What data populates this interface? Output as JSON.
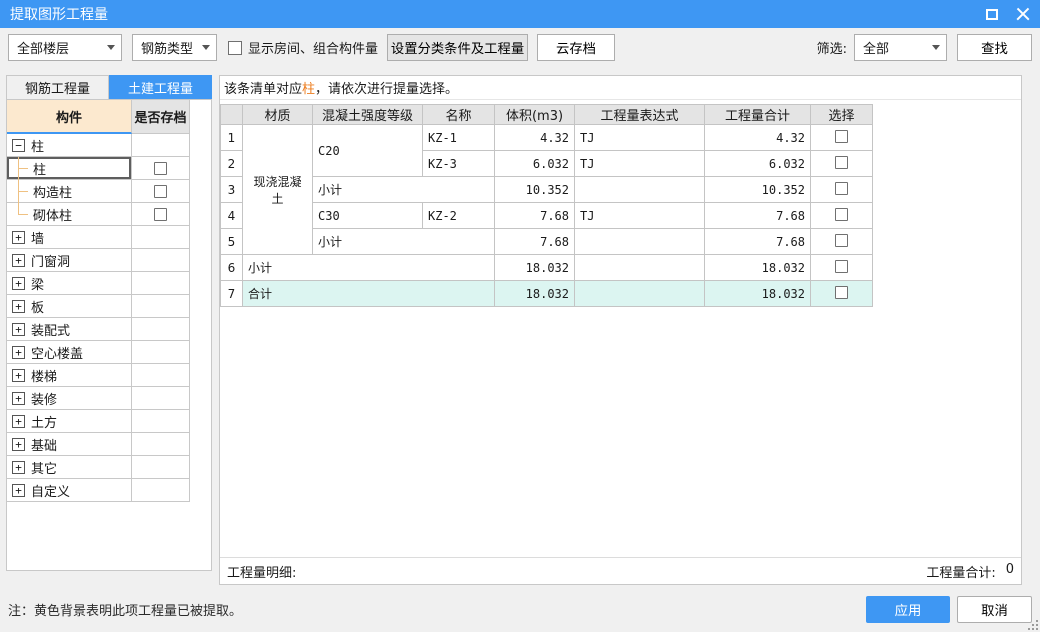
{
  "colors": {
    "accent_blue": "#3e97f3",
    "highlight_orange": "#ed7d1f",
    "tree_header_bg": "#fce9cf",
    "total_row_bg": "#dcf5f1",
    "table_header_bg": "#e4e4e4",
    "dialog_bg": "#f0f0f0"
  },
  "icons": {
    "maximize": "square-outline",
    "close": "x-cross",
    "chevron_down": "triangle-down",
    "expand_glyph": "+",
    "collapse_glyph": "−"
  },
  "window": {
    "title": "提取图形工程量"
  },
  "toolbar": {
    "floor_dropdown_value": "全部楼层",
    "rebar_type_dropdown_value": "钢筋类型",
    "show_room_checkbox_label": "显示房间、组合构件量",
    "set_conditions_button": "设置分类条件及工程量",
    "cloud_save_button": "云存档",
    "filter_label": "筛选:",
    "filter_dropdown_value": "全部",
    "find_button": "查找"
  },
  "sidebar": {
    "tabs": [
      {
        "label": "钢筋工程量",
        "active": false
      },
      {
        "label": "土建工程量",
        "active": true
      }
    ],
    "tree": {
      "headers": [
        "构件",
        "是否存档"
      ],
      "items": [
        {
          "label": "柱",
          "level": 0,
          "expander": "collapse",
          "checkbox": false,
          "selected": false
        },
        {
          "label": "柱",
          "level": 1,
          "expander": "leaf",
          "checkbox": true,
          "selected": true,
          "last": false
        },
        {
          "label": "构造柱",
          "level": 1,
          "expander": "leaf",
          "checkbox": true,
          "selected": false,
          "last": false
        },
        {
          "label": "砌体柱",
          "level": 1,
          "expander": "leaf",
          "checkbox": true,
          "selected": false,
          "last": true
        },
        {
          "label": "墙",
          "level": 0,
          "expander": "expand",
          "checkbox": false,
          "selected": false
        },
        {
          "label": "门窗洞",
          "level": 0,
          "expander": "expand",
          "checkbox": false,
          "selected": false
        },
        {
          "label": "梁",
          "level": 0,
          "expander": "expand",
          "checkbox": false,
          "selected": false
        },
        {
          "label": "板",
          "level": 0,
          "expander": "expand",
          "checkbox": false,
          "selected": false
        },
        {
          "label": "装配式",
          "level": 0,
          "expander": "expand",
          "checkbox": false,
          "selected": false
        },
        {
          "label": "空心楼盖",
          "level": 0,
          "expander": "expand",
          "checkbox": false,
          "selected": false
        },
        {
          "label": "楼梯",
          "level": 0,
          "expander": "expand",
          "checkbox": false,
          "selected": false
        },
        {
          "label": "装修",
          "level": 0,
          "expander": "expand",
          "checkbox": false,
          "selected": false
        },
        {
          "label": "土方",
          "level": 0,
          "expander": "expand",
          "checkbox": false,
          "selected": false
        },
        {
          "label": "基础",
          "level": 0,
          "expander": "expand",
          "checkbox": false,
          "selected": false
        },
        {
          "label": "其它",
          "level": 0,
          "expander": "expand",
          "checkbox": false,
          "selected": false
        },
        {
          "label": "自定义",
          "level": 0,
          "expander": "expand",
          "checkbox": false,
          "selected": false
        }
      ]
    }
  },
  "main": {
    "message": {
      "prefix": "该条清单对应",
      "highlight": "柱",
      "suffix": "，请依次进行提量选择。"
    },
    "table": {
      "headers": [
        "材质",
        "混凝土强度等级",
        "名称",
        "体积(m3)",
        "工程量表达式",
        "工程量合计",
        "选择"
      ],
      "rows": [
        {
          "num": "1",
          "highlight": false,
          "cells": [
            {
              "col": "material",
              "text": "现浇混凝土",
              "rowspan": 5,
              "center": true
            },
            {
              "col": "grade",
              "text": "C20",
              "rowspan": 2
            },
            {
              "col": "name",
              "text": "KZ-1"
            },
            {
              "col": "volume",
              "text": "4.32",
              "align": "right"
            },
            {
              "col": "expr",
              "text": "TJ"
            },
            {
              "col": "total",
              "text": "4.32",
              "align": "right"
            },
            {
              "col": "select",
              "checkbox": true
            }
          ]
        },
        {
          "num": "2",
          "highlight": false,
          "cells": [
            {
              "col": "name",
              "text": "KZ-3"
            },
            {
              "col": "volume",
              "text": "6.032",
              "align": "right"
            },
            {
              "col": "expr",
              "text": "TJ"
            },
            {
              "col": "total",
              "text": "6.032",
              "align": "right"
            },
            {
              "col": "select",
              "checkbox": true
            }
          ]
        },
        {
          "num": "3",
          "highlight": false,
          "cells": [
            {
              "col": "grade",
              "text": "小计",
              "colspan": 2
            },
            {
              "col": "volume",
              "text": "10.352",
              "align": "right"
            },
            {
              "col": "expr",
              "text": ""
            },
            {
              "col": "total",
              "text": "10.352",
              "align": "right"
            },
            {
              "col": "select",
              "checkbox": true
            }
          ]
        },
        {
          "num": "4",
          "highlight": false,
          "cells": [
            {
              "col": "grade",
              "text": "C30"
            },
            {
              "col": "name",
              "text": "KZ-2"
            },
            {
              "col": "volume",
              "text": "7.68",
              "align": "right"
            },
            {
              "col": "expr",
              "text": "TJ"
            },
            {
              "col": "total",
              "text": "7.68",
              "align": "right"
            },
            {
              "col": "select",
              "checkbox": true
            }
          ]
        },
        {
          "num": "5",
          "highlight": false,
          "cells": [
            {
              "col": "grade",
              "text": "小计",
              "colspan": 2
            },
            {
              "col": "volume",
              "text": "7.68",
              "align": "right"
            },
            {
              "col": "expr",
              "text": ""
            },
            {
              "col": "total",
              "text": "7.68",
              "align": "right"
            },
            {
              "col": "select",
              "checkbox": true
            }
          ]
        },
        {
          "num": "6",
          "highlight": false,
          "cells": [
            {
              "col": "material",
              "text": "小计",
              "colspan": 3
            },
            {
              "col": "volume",
              "text": "18.032",
              "align": "right"
            },
            {
              "col": "expr",
              "text": ""
            },
            {
              "col": "total",
              "text": "18.032",
              "align": "right"
            },
            {
              "col": "select",
              "checkbox": true
            }
          ]
        },
        {
          "num": "7",
          "highlight": true,
          "cells": [
            {
              "col": "material",
              "text": "合计",
              "colspan": 3
            },
            {
              "col": "volume",
              "text": "18.032",
              "align": "right"
            },
            {
              "col": "expr",
              "text": ""
            },
            {
              "col": "total",
              "text": "18.032",
              "align": "right"
            },
            {
              "col": "select",
              "checkbox": true
            }
          ]
        }
      ]
    },
    "status": {
      "detail_label": "工程量明细:",
      "total_label": "工程量合计:",
      "total_value": "0"
    }
  },
  "footer": {
    "note": "注：黄色背景表明此项工程量已被提取。",
    "apply_button": "应用",
    "cancel_button": "取消"
  }
}
